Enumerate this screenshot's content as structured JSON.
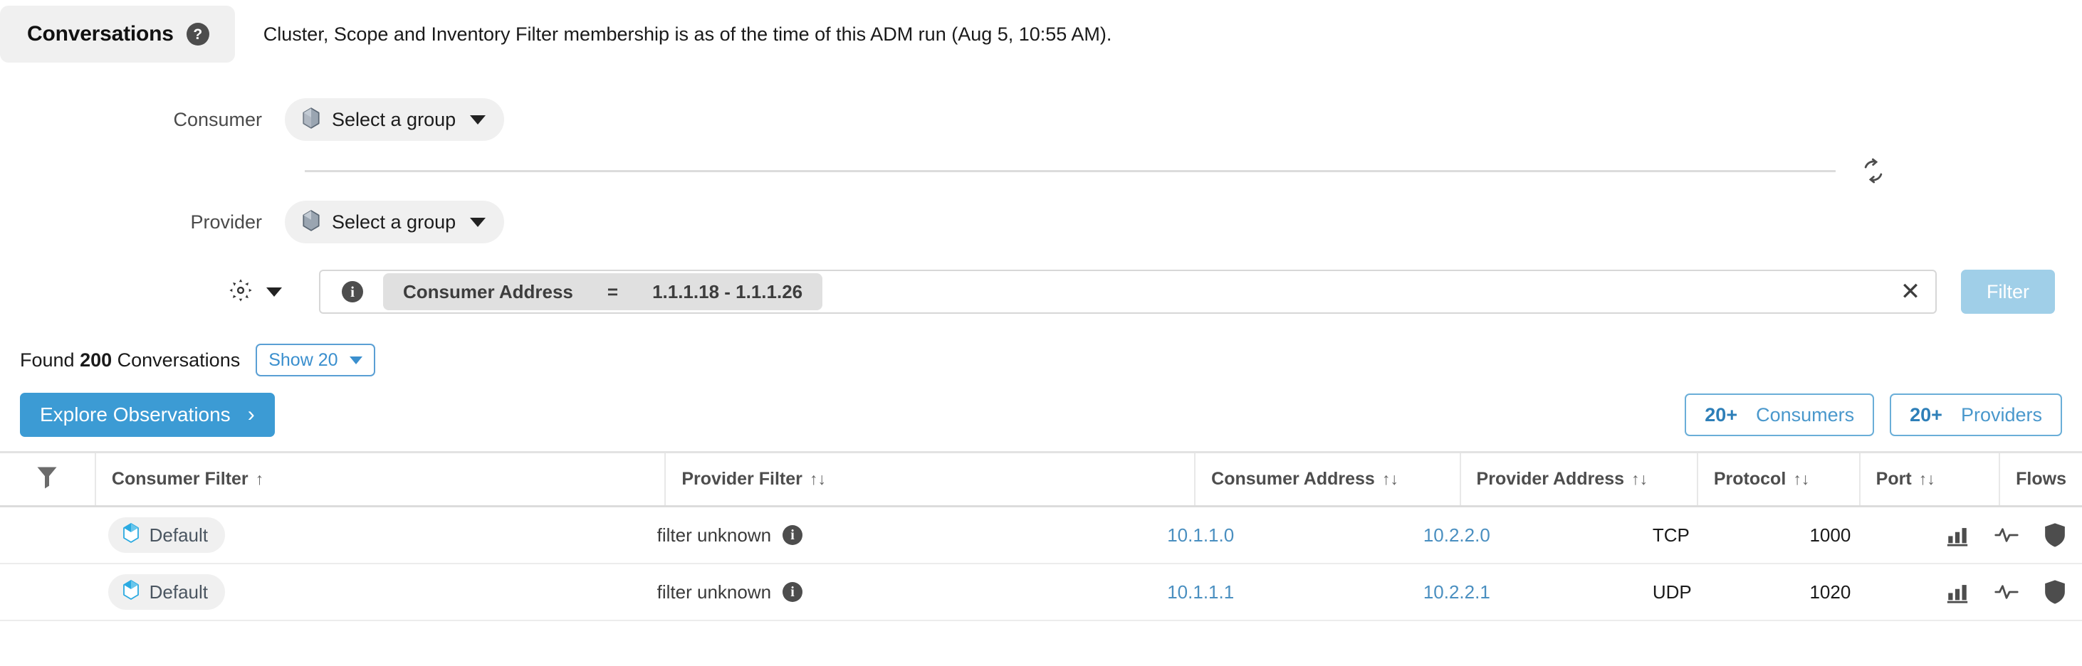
{
  "header": {
    "tab_label": "Conversations",
    "help_icon": "help-circle-icon",
    "note": "Cluster, Scope and Inventory Filter membership is as of the time of this ADM run (Aug 5, 10:55 AM)."
  },
  "selectors": {
    "consumer_label": "Consumer",
    "consumer_value": "Select a group",
    "provider_label": "Provider",
    "provider_value": "Select a group",
    "swap_icon": "refresh-swap-icon",
    "group_icon": "cube-icon"
  },
  "filter_bar": {
    "gear_icon": "gear-icon",
    "info_icon": "info-icon",
    "chip_field": "Consumer Address",
    "chip_operator": "=",
    "chip_value": "1.1.1.18 - 1.1.1.26",
    "clear_icon": "close-icon",
    "filter_button": "Filter",
    "filter_button_enabled": false,
    "filter_button_color": "#a0cfe8"
  },
  "results": {
    "found_prefix": "Found ",
    "found_count": "200",
    "found_suffix": " Conversations",
    "show_label": "Show 20",
    "explore_label": "Explore Observations",
    "explore_chevron": "›",
    "explore_color": "#3c9bd4",
    "consumers_count": "20+",
    "consumers_label": "Consumers",
    "providers_count": "20+",
    "providers_label": "Providers"
  },
  "table": {
    "filter_icon": "funnel-filter-icon",
    "columns": [
      {
        "label": "Consumer Filter",
        "sort": "↑"
      },
      {
        "label": "Provider Filter",
        "sort": "↑↓"
      },
      {
        "label": "Consumer Address",
        "sort": "↑↓"
      },
      {
        "label": "Provider Address",
        "sort": "↑↓"
      },
      {
        "label": "Protocol",
        "sort": "↑↓"
      },
      {
        "label": "Port",
        "sort": "↑↓"
      },
      {
        "label": "Flows",
        "sort": ""
      }
    ],
    "rows": [
      {
        "consumer_filter": "Default",
        "provider_filter": "filter unknown",
        "consumer_address": "10.1.1.0",
        "provider_address": "10.2.2.0",
        "protocol": "TCP",
        "port": "1000",
        "flow_icons": [
          "bar-chart-icon",
          "activity-pulse-icon",
          "shield-icon"
        ]
      },
      {
        "consumer_filter": "Default",
        "provider_filter": "filter unknown",
        "consumer_address": "10.1.1.1",
        "provider_address": "10.2.2.1",
        "protocol": "UDP",
        "port": "1020",
        "flow_icons": [
          "bar-chart-icon",
          "activity-pulse-icon",
          "shield-icon"
        ]
      }
    ]
  }
}
